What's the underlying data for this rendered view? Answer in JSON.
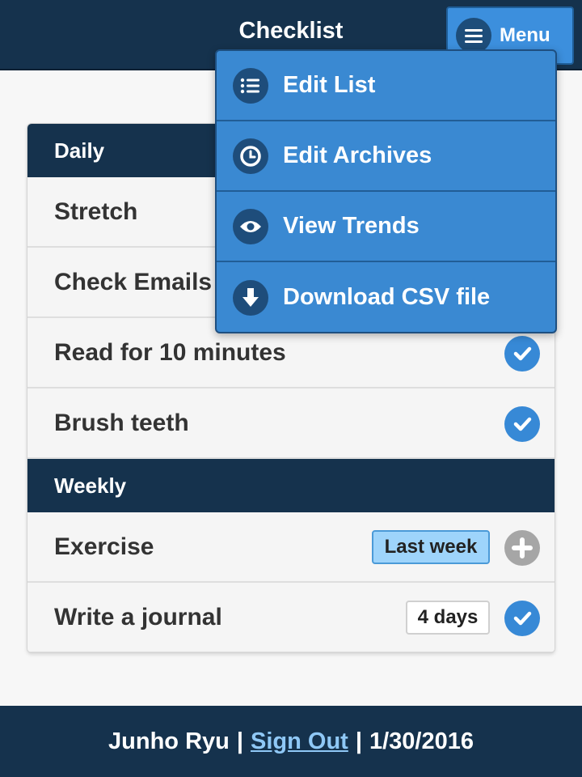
{
  "header": {
    "title": "Checklist",
    "menu_label": "Menu"
  },
  "menu": {
    "items": [
      {
        "label": "Edit List",
        "icon": "list-icon"
      },
      {
        "label": "Edit Archives",
        "icon": "clock-icon"
      },
      {
        "label": "View Trends",
        "icon": "eye-icon"
      },
      {
        "label": "Download CSV file",
        "icon": "download-icon"
      }
    ]
  },
  "checklist": {
    "daily": {
      "title": "Daily",
      "items": [
        {
          "label": "Stretch"
        },
        {
          "label": "Check Emails"
        },
        {
          "label": "Read for 10 minutes",
          "status": "checked"
        },
        {
          "label": "Brush teeth",
          "status": "checked"
        }
      ]
    },
    "weekly": {
      "title": "Weekly",
      "items": [
        {
          "label": "Exercise",
          "badge": "Last week",
          "status": "add"
        },
        {
          "label": "Write a journal",
          "badge": "4 days",
          "status": "checked"
        }
      ]
    }
  },
  "footer": {
    "user": "Junho Ryu",
    "separator": "|",
    "sign_out": "Sign Out",
    "date": "1/30/2016"
  },
  "colors": {
    "navy": "#15324d",
    "accent_blue": "#3a89d2",
    "check_blue": "#3789d6",
    "badge_light_blue": "#9ed4fb",
    "link_blue": "#8fc8f6"
  }
}
